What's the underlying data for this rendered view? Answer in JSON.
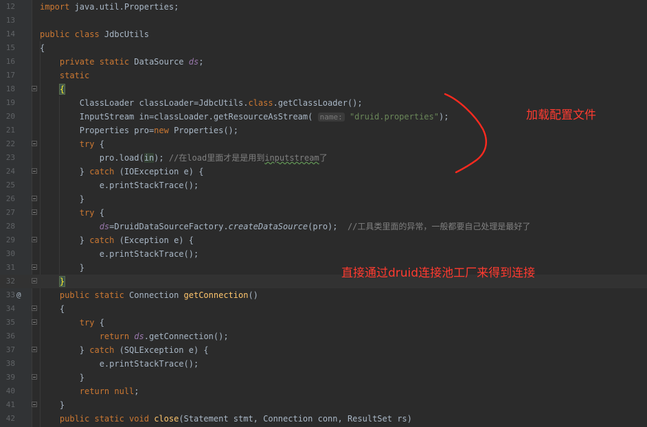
{
  "editor": {
    "lines": [
      {
        "num": "12",
        "gutter": "",
        "fold": false,
        "current": false,
        "tokens": [
          {
            "t": "import",
            "c": "kw"
          },
          {
            "t": " java.util.Properties;"
          }
        ]
      },
      {
        "num": "13",
        "gutter": "",
        "fold": false,
        "current": false,
        "tokens": []
      },
      {
        "num": "14",
        "gutter": "",
        "fold": false,
        "current": false,
        "tokens": [
          {
            "t": "public class",
            "c": "kw"
          },
          {
            "t": " JdbcUtils"
          }
        ]
      },
      {
        "num": "15",
        "gutter": "",
        "fold": false,
        "current": false,
        "tokens": [
          {
            "t": "{"
          }
        ]
      },
      {
        "num": "16",
        "gutter": "",
        "fold": false,
        "current": false,
        "tokens": [
          {
            "t": "    "
          },
          {
            "t": "private static",
            "c": "kw"
          },
          {
            "t": " DataSource "
          },
          {
            "t": "ds",
            "c": "fld"
          },
          {
            "t": ";"
          }
        ]
      },
      {
        "num": "17",
        "gutter": "",
        "fold": false,
        "current": false,
        "tokens": [
          {
            "t": "    "
          },
          {
            "t": "static",
            "c": "kw"
          }
        ]
      },
      {
        "num": "18",
        "gutter": "",
        "fold": true,
        "current": false,
        "tokens": [
          {
            "t": "    "
          },
          {
            "t": "{",
            "c": "brace-hl"
          }
        ]
      },
      {
        "num": "19",
        "gutter": "",
        "fold": false,
        "current": false,
        "tokens": [
          {
            "t": "        ClassLoader classLoader=JdbcUtils."
          },
          {
            "t": "class",
            "c": "kw"
          },
          {
            "t": ".getClassLoader();"
          }
        ]
      },
      {
        "num": "20",
        "gutter": "",
        "fold": false,
        "current": false,
        "tokens": [
          {
            "t": "        InputStream in=classLoader.getResourceAsStream( "
          },
          {
            "t": "name:",
            "c": "hint"
          },
          {
            "t": " "
          },
          {
            "t": "\"druid.properties\"",
            "c": "str"
          },
          {
            "t": ");"
          }
        ]
      },
      {
        "num": "21",
        "gutter": "",
        "fold": false,
        "current": false,
        "tokens": [
          {
            "t": "        Properties pro="
          },
          {
            "t": "new",
            "c": "kw"
          },
          {
            "t": " Properties();"
          }
        ]
      },
      {
        "num": "22",
        "gutter": "",
        "fold": true,
        "current": false,
        "tokens": [
          {
            "t": "        "
          },
          {
            "t": "try",
            "c": "kw"
          },
          {
            "t": " {"
          }
        ]
      },
      {
        "num": "23",
        "gutter": "",
        "fold": false,
        "current": false,
        "tokens": [
          {
            "t": "            pro.load("
          },
          {
            "t": "in",
            "c": "var-hl"
          },
          {
            "t": "); "
          },
          {
            "t": "//在load里面才是是用到",
            "c": "cmt"
          },
          {
            "t": "inputstream",
            "c": "cmt wavy"
          },
          {
            "t": "了",
            "c": "cmt"
          }
        ]
      },
      {
        "num": "24",
        "gutter": "",
        "fold": true,
        "current": false,
        "tokens": [
          {
            "t": "        } "
          },
          {
            "t": "catch",
            "c": "kw"
          },
          {
            "t": " (IOException e) {"
          }
        ]
      },
      {
        "num": "25",
        "gutter": "",
        "fold": false,
        "current": false,
        "tokens": [
          {
            "t": "            e.printStackTrace();"
          }
        ]
      },
      {
        "num": "26",
        "gutter": "",
        "fold": true,
        "current": false,
        "tokens": [
          {
            "t": "        }"
          }
        ]
      },
      {
        "num": "27",
        "gutter": "",
        "fold": true,
        "current": false,
        "tokens": [
          {
            "t": "        "
          },
          {
            "t": "try",
            "c": "kw"
          },
          {
            "t": " {"
          }
        ]
      },
      {
        "num": "28",
        "gutter": "",
        "fold": false,
        "current": false,
        "tokens": [
          {
            "t": "            "
          },
          {
            "t": "ds",
            "c": "fld"
          },
          {
            "t": "=DruidDataSourceFactory."
          },
          {
            "t": "createDataSource",
            "c": "it"
          },
          {
            "t": "(pro);  "
          },
          {
            "t": "//工具类里面的异常，一般都要自己处理是最好了",
            "c": "cmt"
          }
        ]
      },
      {
        "num": "29",
        "gutter": "",
        "fold": true,
        "current": false,
        "tokens": [
          {
            "t": "        } "
          },
          {
            "t": "catch",
            "c": "kw"
          },
          {
            "t": " (Exception e) {"
          }
        ]
      },
      {
        "num": "30",
        "gutter": "",
        "fold": false,
        "current": false,
        "tokens": [
          {
            "t": "            e.printStackTrace();"
          }
        ]
      },
      {
        "num": "31",
        "gutter": "",
        "fold": true,
        "current": false,
        "tokens": [
          {
            "t": "        }"
          }
        ]
      },
      {
        "num": "32",
        "gutter": "",
        "fold": true,
        "current": true,
        "tokens": [
          {
            "t": "    "
          },
          {
            "t": "}",
            "c": "brace-hl"
          }
        ]
      },
      {
        "num": "33",
        "gutter": "@",
        "fold": false,
        "current": false,
        "tokens": [
          {
            "t": "    "
          },
          {
            "t": "public static",
            "c": "kw"
          },
          {
            "t": " Connection "
          },
          {
            "t": "getConnection",
            "c": "fn"
          },
          {
            "t": "()"
          }
        ]
      },
      {
        "num": "34",
        "gutter": "",
        "fold": true,
        "current": false,
        "tokens": [
          {
            "t": "    {"
          }
        ]
      },
      {
        "num": "35",
        "gutter": "",
        "fold": true,
        "current": false,
        "tokens": [
          {
            "t": "        "
          },
          {
            "t": "try",
            "c": "kw"
          },
          {
            "t": " {"
          }
        ]
      },
      {
        "num": "36",
        "gutter": "",
        "fold": false,
        "current": false,
        "tokens": [
          {
            "t": "            "
          },
          {
            "t": "return",
            "c": "kw"
          },
          {
            "t": " "
          },
          {
            "t": "ds",
            "c": "fld"
          },
          {
            "t": ".getConnection();"
          }
        ]
      },
      {
        "num": "37",
        "gutter": "",
        "fold": true,
        "current": false,
        "tokens": [
          {
            "t": "        } "
          },
          {
            "t": "catch",
            "c": "kw"
          },
          {
            "t": " (SQLException e) {"
          }
        ]
      },
      {
        "num": "38",
        "gutter": "",
        "fold": false,
        "current": false,
        "tokens": [
          {
            "t": "            e.printStackTrace();"
          }
        ]
      },
      {
        "num": "39",
        "gutter": "",
        "fold": true,
        "current": false,
        "tokens": [
          {
            "t": "        }"
          }
        ]
      },
      {
        "num": "40",
        "gutter": "",
        "fold": false,
        "current": false,
        "tokens": [
          {
            "t": "        "
          },
          {
            "t": "return null",
            "c": "kw"
          },
          {
            "t": ";"
          }
        ]
      },
      {
        "num": "41",
        "gutter": "",
        "fold": true,
        "current": false,
        "tokens": [
          {
            "t": "    }"
          }
        ]
      },
      {
        "num": "42",
        "gutter": "",
        "fold": false,
        "current": false,
        "tokens": [
          {
            "t": "    "
          },
          {
            "t": "public static void",
            "c": "kw"
          },
          {
            "t": " "
          },
          {
            "t": "close",
            "c": "fn"
          },
          {
            "t": "(Statement stmt, Connection conn, ResultSet rs)"
          }
        ]
      }
    ]
  },
  "annotations": {
    "load_config": "加载配置文件",
    "druid_pool": "直接通过druid连接池工厂来得到连接"
  },
  "colors": {
    "background": "#2b2b2b",
    "keyword": "#cc7832",
    "string": "#6a8759",
    "comment": "#808080",
    "field": "#9876aa",
    "method": "#ffc66d",
    "annotation_red": "#ff3b30"
  }
}
